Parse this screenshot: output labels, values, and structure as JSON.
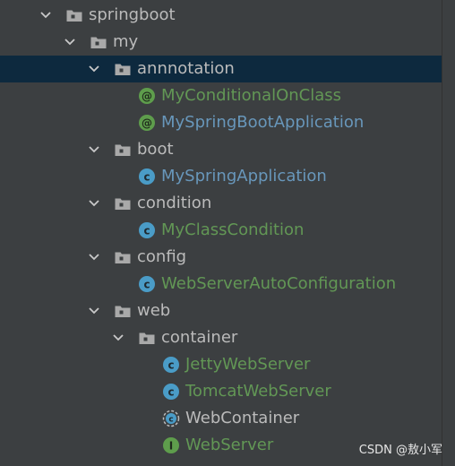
{
  "tree": {
    "nodes": [
      {
        "label": "springboot",
        "kind": "package",
        "depth": 0,
        "expanded": true
      },
      {
        "label": "my",
        "kind": "package",
        "depth": 1,
        "expanded": true
      },
      {
        "label": "annnotation",
        "kind": "package",
        "depth": 2,
        "expanded": true,
        "selected": true
      },
      {
        "label": "MyConditionalOnClass",
        "kind": "annotation",
        "depth": 3,
        "color": "green"
      },
      {
        "label": "MySpringBootApplication",
        "kind": "annotation",
        "depth": 3,
        "color": "blue"
      },
      {
        "label": "boot",
        "kind": "package",
        "depth": 2,
        "expanded": true
      },
      {
        "label": "MySpringApplication",
        "kind": "class",
        "depth": 3,
        "color": "blue"
      },
      {
        "label": "condition",
        "kind": "package",
        "depth": 2,
        "expanded": true
      },
      {
        "label": "MyClassCondition",
        "kind": "class",
        "depth": 3,
        "color": "green"
      },
      {
        "label": "config",
        "kind": "package",
        "depth": 2,
        "expanded": true
      },
      {
        "label": "WebServerAutoConfiguration",
        "kind": "class",
        "depth": 3,
        "color": "green"
      },
      {
        "label": "web",
        "kind": "package",
        "depth": 2,
        "expanded": true
      },
      {
        "label": "container",
        "kind": "package",
        "depth": 3,
        "expanded": true
      },
      {
        "label": "JettyWebServer",
        "kind": "class",
        "depth": 4,
        "color": "green"
      },
      {
        "label": "TomcatWebServer",
        "kind": "class",
        "depth": 4,
        "color": "green"
      },
      {
        "label": "WebContainer",
        "kind": "abstract-class",
        "depth": 4,
        "color": "white"
      },
      {
        "label": "WebServer",
        "kind": "interface",
        "depth": 4,
        "color": "green"
      }
    ]
  },
  "watermark": "CSDN @敖小军",
  "colors": {
    "background": "#3c3f41",
    "selected_row": "#0d293e",
    "text_default": "#bbbbbb",
    "text_green": "#629755",
    "text_blue": "#6897bb",
    "icon_class": "#4a9cc7",
    "icon_annotation": "#5e9d4c",
    "icon_interface": "#5e9d4c"
  },
  "icons": {
    "package": "package-icon",
    "class": "class-icon",
    "annotation": "annotation-icon",
    "abstract-class": "abstract-class-icon",
    "interface": "interface-icon",
    "expanded": "chevron-down-icon"
  }
}
